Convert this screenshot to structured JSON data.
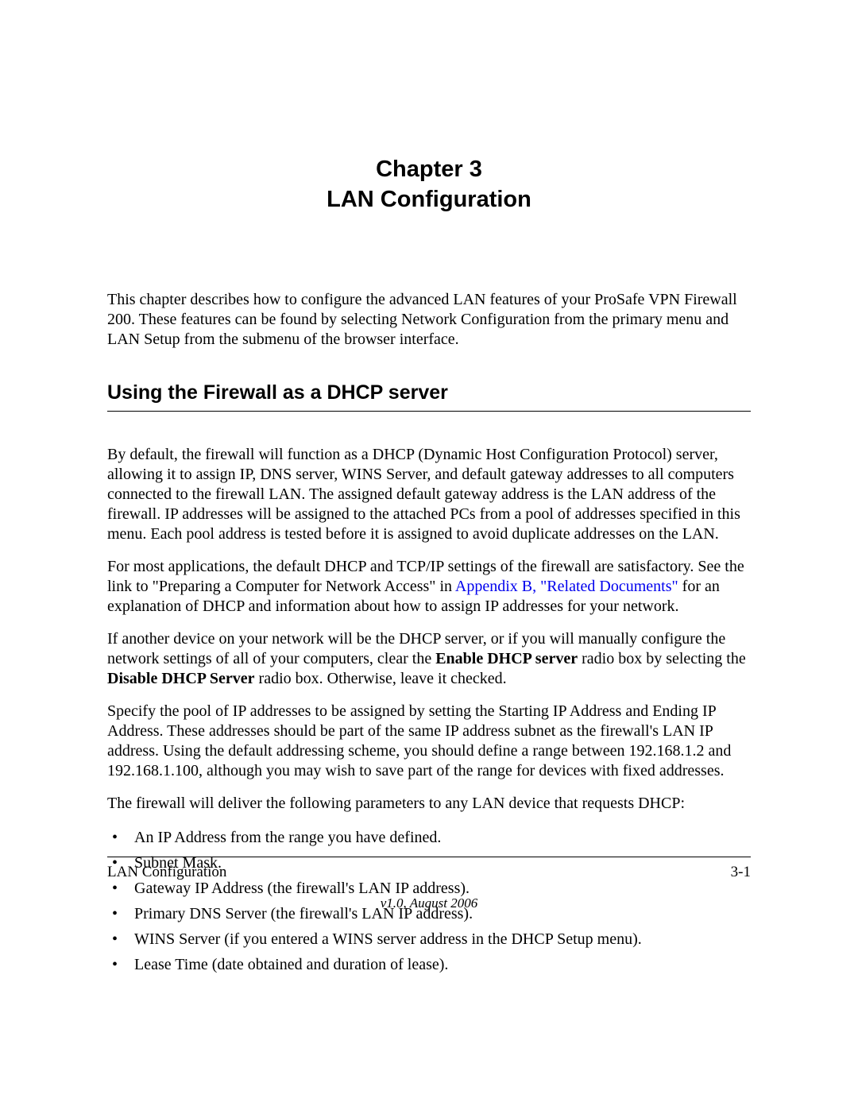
{
  "chapter": {
    "label": "Chapter 3",
    "title": "LAN Configuration"
  },
  "intro": "This chapter describes how to configure the advanced LAN features of your ProSafe VPN Firewall 200. These features can be found by selecting Network Configuration from the primary menu and LAN Setup from the submenu of the browser interface.",
  "section_heading": "Using the Firewall as a DHCP server",
  "para1": "By default, the firewall will function as a DHCP (Dynamic Host Configuration Protocol) server, allowing it to assign IP, DNS server, WINS Server, and default gateway addresses to all computers connected to the firewall LAN. The assigned default gateway address is the LAN address of the firewall. IP addresses will be assigned to the attached PCs from a pool of addresses specified in this menu. Each pool address is tested before it is assigned to avoid duplicate addresses on the LAN.",
  "para2": {
    "pre": "For most applications, the default DHCP and TCP/IP settings of the firewall are satisfactory. See the link to \"Preparing a Computer for Network Access\" in ",
    "link": "Appendix B, \"Related Documents\"",
    "post": " for an explanation of DHCP and information about how to assign IP addresses for your network."
  },
  "para3": {
    "pre": "If another device on your network will be the DHCP server, or if you will manually configure the network settings of all of your computers, clear the ",
    "bold1": "Enable DHCP server",
    "mid": " radio box by selecting the ",
    "bold2": "Disable DHCP Server",
    "post": " radio box. Otherwise, leave it checked."
  },
  "para4": "Specify the pool of IP addresses to be assigned by setting the Starting IP Address and Ending IP Address. These addresses should be part of the same IP address subnet as the firewall's LAN IP address. Using the default addressing scheme, you should define a range between 192.168.1.2 and 192.168.1.100, although you may wish to save part of the range for devices with fixed addresses.",
  "para5": "The firewall will deliver the following parameters to any LAN device that requests DHCP:",
  "bullets": [
    "An IP Address from the range you have defined.",
    "Subnet Mask.",
    "Gateway IP Address (the firewall's LAN IP address).",
    "Primary DNS Server (the firewall's LAN IP address).",
    "WINS Server (if you entered a WINS server address in the DHCP Setup menu).",
    "Lease Time (date obtained and duration of lease)."
  ],
  "footer": {
    "left": "LAN Configuration",
    "right": "3-1",
    "version": "v1.0, August 2006"
  }
}
